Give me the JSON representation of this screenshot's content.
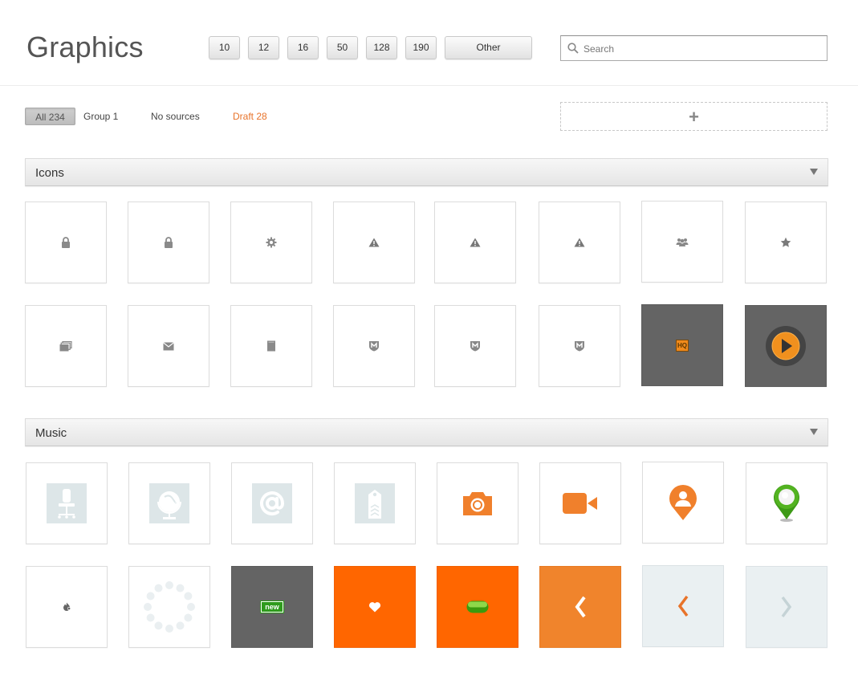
{
  "header": {
    "title": "Graphics",
    "size_buttons": [
      "10",
      "12",
      "16",
      "50",
      "128",
      "190"
    ],
    "other_label": "Other",
    "search_placeholder": "Search"
  },
  "filters": {
    "all": "All 234",
    "group1": "Group 1",
    "no_sources": "No sources",
    "draft": "Draft 28"
  },
  "add_button": "+",
  "sections": {
    "icons": {
      "label": "Icons"
    },
    "music": {
      "label": "Music"
    }
  },
  "icons_tiles": [
    "lock-icon",
    "lock-icon",
    "gear-icon",
    "warning-icon",
    "warning-icon",
    "warning-icon",
    "users-group-icon",
    "star-icon",
    "windows-stack-icon",
    "mail-icon",
    "document-icon",
    "shield-m-icon",
    "shield-m-icon",
    "shield-m-icon",
    "hq-badge-icon",
    "play-button-icon"
  ],
  "hq_label": "HQ",
  "music_tiles": [
    "office-chair-icon",
    "globe-icon",
    "at-sign-icon",
    "shipping-tag-icon",
    "camera-icon",
    "video-camera-icon",
    "map-pin-person-icon",
    "green-map-pin-icon",
    "fire-icon",
    "loading-spinner-icon",
    "new-badge-icon",
    "heart-icon",
    "green-pill-icon",
    "chevron-left-icon",
    "chevron-left-icon",
    "chevron-right-icon"
  ],
  "new_label": "new",
  "colors": {
    "accent_orange": "#ff6600",
    "draft_orange": "#e8732a",
    "dark_tile": "#646464",
    "green": "#2e9b1c",
    "pale_blue": "#dde6e8"
  }
}
